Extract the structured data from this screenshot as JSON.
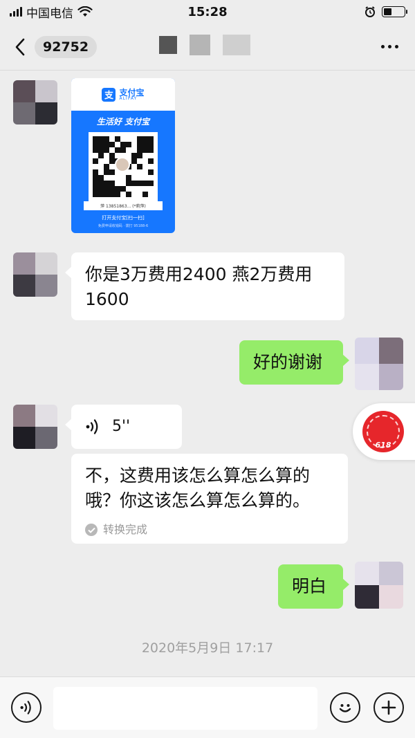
{
  "status_bar": {
    "carrier": "中国电信",
    "time": "15:28"
  },
  "nav": {
    "unread_count": "92752"
  },
  "messages": [
    {
      "side": "left",
      "type": "image",
      "alipay_card": {
        "brand_cn": "支付宝",
        "brand_en": "ALIPAY",
        "logo_glyph": "支",
        "slogan": "生活好 支付宝",
        "caption": "萍 13851863... (*莉萍)",
        "open_text": "打开支付宝[扫一扫]",
        "tip_text": "免费申请收钱码 · 拨打 95188-6"
      }
    },
    {
      "side": "left",
      "type": "text",
      "text_line1": "你是3万费用2400 燕2万费用",
      "text_line2": "1600"
    },
    {
      "side": "right",
      "type": "text",
      "text": "好的谢谢"
    },
    {
      "side": "left",
      "type": "voice",
      "duration": "5''",
      "transcript_line1": "不，这费用该怎么算怎么算的",
      "transcript_line2": "哦？你这该怎么算怎么算的。",
      "convert_status": "转换完成"
    },
    {
      "side": "right",
      "type": "text",
      "text": "明白"
    }
  ],
  "timestamp": "2020年5月9日 17:17",
  "float_badge": {
    "text": "618"
  },
  "colors": {
    "background": "#ededed",
    "outgoing_bubble": "#95ec69",
    "incoming_bubble": "#ffffff",
    "alipay_blue": "#1677ff",
    "badge_red": "#e6262b"
  },
  "icons": {
    "back": "chevron-left-icon",
    "more": "more-dots-icon",
    "voice": "voice-wave-icon",
    "emoji": "emoji-icon",
    "add": "plus-circle-icon",
    "check": "check-circle-icon"
  }
}
